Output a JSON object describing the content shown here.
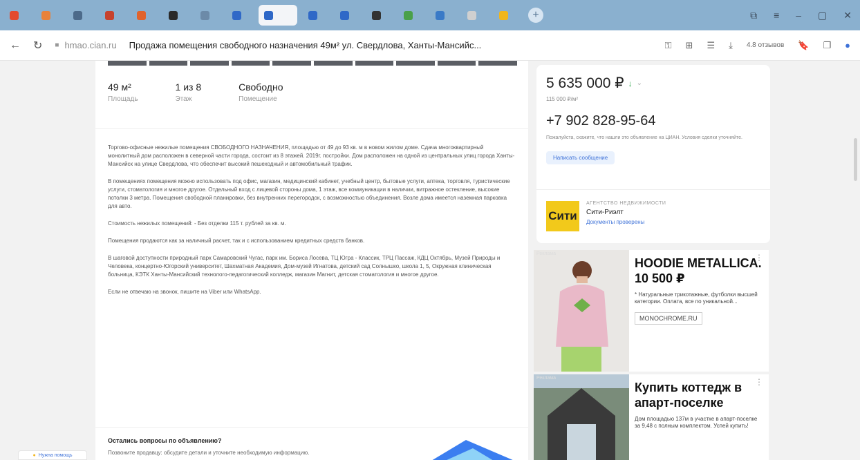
{
  "browser": {
    "tabs": [
      {
        "label": "",
        "color": "#e34a2e",
        "active": false
      },
      {
        "label": "",
        "color": "#e8823a",
        "active": false
      },
      {
        "label": "",
        "color": "#4c6a8a",
        "active": false
      },
      {
        "label": "",
        "color": "#c7422d",
        "active": false
      },
      {
        "label": "",
        "color": "#e0632d",
        "active": false
      },
      {
        "label": "",
        "color": "#2a2a2a",
        "active": false
      },
      {
        "label": "",
        "color": "#6c8aa8",
        "active": false
      },
      {
        "label": "",
        "color": "#2f68c7",
        "active": false
      },
      {
        "label": "",
        "color": "#2f68c7",
        "active": true
      },
      {
        "label": "",
        "color": "#2f68c7",
        "active": false
      },
      {
        "label": "",
        "color": "#2f68c7",
        "active": false
      },
      {
        "label": "",
        "color": "#333333",
        "active": false
      },
      {
        "label": "",
        "color": "#4aa04a",
        "active": false
      },
      {
        "label": "",
        "color": "#3a7ac7",
        "active": false
      },
      {
        "label": "",
        "color": "#d0d0d0",
        "active": false
      },
      {
        "label": "",
        "color": "#f2b61b",
        "active": false
      }
    ],
    "domain": "hmao.cian.ru",
    "page_title": "Продажа помещения свободного назначения 49м² ул. Свердлова, Ханты-Мансийс...",
    "reviews": "4.8 отзывов"
  },
  "listing": {
    "specs": [
      {
        "value": "49 м²",
        "label": "Площадь"
      },
      {
        "value": "1 из 8",
        "label": "Этаж"
      },
      {
        "value": "Свободно",
        "label": "Помещение"
      }
    ],
    "description": [
      "Торгово-офисные нежилые помещения СВОБОДНОГО НАЗНАЧЕНИЯ, площадью от 49 до 93 кв. м в новом жилом доме. Сдача многоквартирный монолитный дом расположен в северной части города, состоит из 8 этажей. 2019г. постройки. Дом расположен на одной из центральных улиц города Ханты-Мансийск на улице Свердлова, что обеспечит высокий пешеходный и автомобильный трафик.",
      "В помещениях помещения можно использовать под офис, магазин, медицинский кабинет, учебный центр, бытовые услуги, аптека, торговля, туристические услуги, стоматология и многое другое. Отдельный вход с лицевой стороны дома, 1 этаж, все коммуникации в наличии, витражное остекление, высокие потолки 3 метра. Помещения свободной планировки, без внутренних перегородок, с возможностью объединения. Возле дома имеется наземная парковка для авто.",
      "Стоимость нежилых помещений: - Без отделки 115 т. рублей за кв. м.",
      "Помещения продаются как за наличный расчет, так и с использованием кредитных средств банков.",
      "В шаговой доступности природный парк Самаровский Чугас, парк им. Бориса Лосева, ТЦ Югра - Классик, ТРЦ Пассаж, КДЦ Октябрь, Музей Природы и Человека, концертно-Югорский университет, Шахматная Академия, Дом-музей Игнатова, детский сад Солнышко, школа 1, 5, Окружная клиническая больница, КЭТК Ханты-Мансийский технолого-педагогический колледж, магазин Магнит, детская стоматология и многое другое.",
      "Если не отвечаю на звонок, пишите на Viber или WhatsApp."
    ],
    "questions_title": "Остались вопросы по объявлению?",
    "questions_sub": "Позвоните продавцу: обсудите детали и уточните необходимую информацию."
  },
  "seller_card": {
    "price": "5 635 000 ₽",
    "price_per_m2": "115 000 ₽/м²",
    "phone": "+7 902 828-95-64",
    "note": "Пожалуйста, скажите, что нашли это объявление на ЦИАН. Условия сделки уточняйте.",
    "message_button": "Написать сообщение",
    "seller_type": "АГЕНТСТВО НЕДВИЖИМОСТИ",
    "seller_name": "Сити-Риэлт",
    "seller_verified": "Документы проверены",
    "logo_text": "Сити",
    "accent": "#3e72d8"
  },
  "ads": [
    {
      "label": "Реклама",
      "title": "HOODIE METALLICA. 10 500 ₽",
      "desc": "* Натуральные трикотажные, футболки высшей категории. Оплата, все по уникальной...",
      "domain": "MONOCHROME.RU"
    },
    {
      "label": "Реклама",
      "title": "Купить коттедж в апарт-поселке",
      "desc": "Дом площадью 137м в участке в апарт-поселке за 9,48 с полным комплектом. Успей купить!",
      "domain": ""
    }
  ],
  "help": {
    "label": "Нужна помощь"
  }
}
